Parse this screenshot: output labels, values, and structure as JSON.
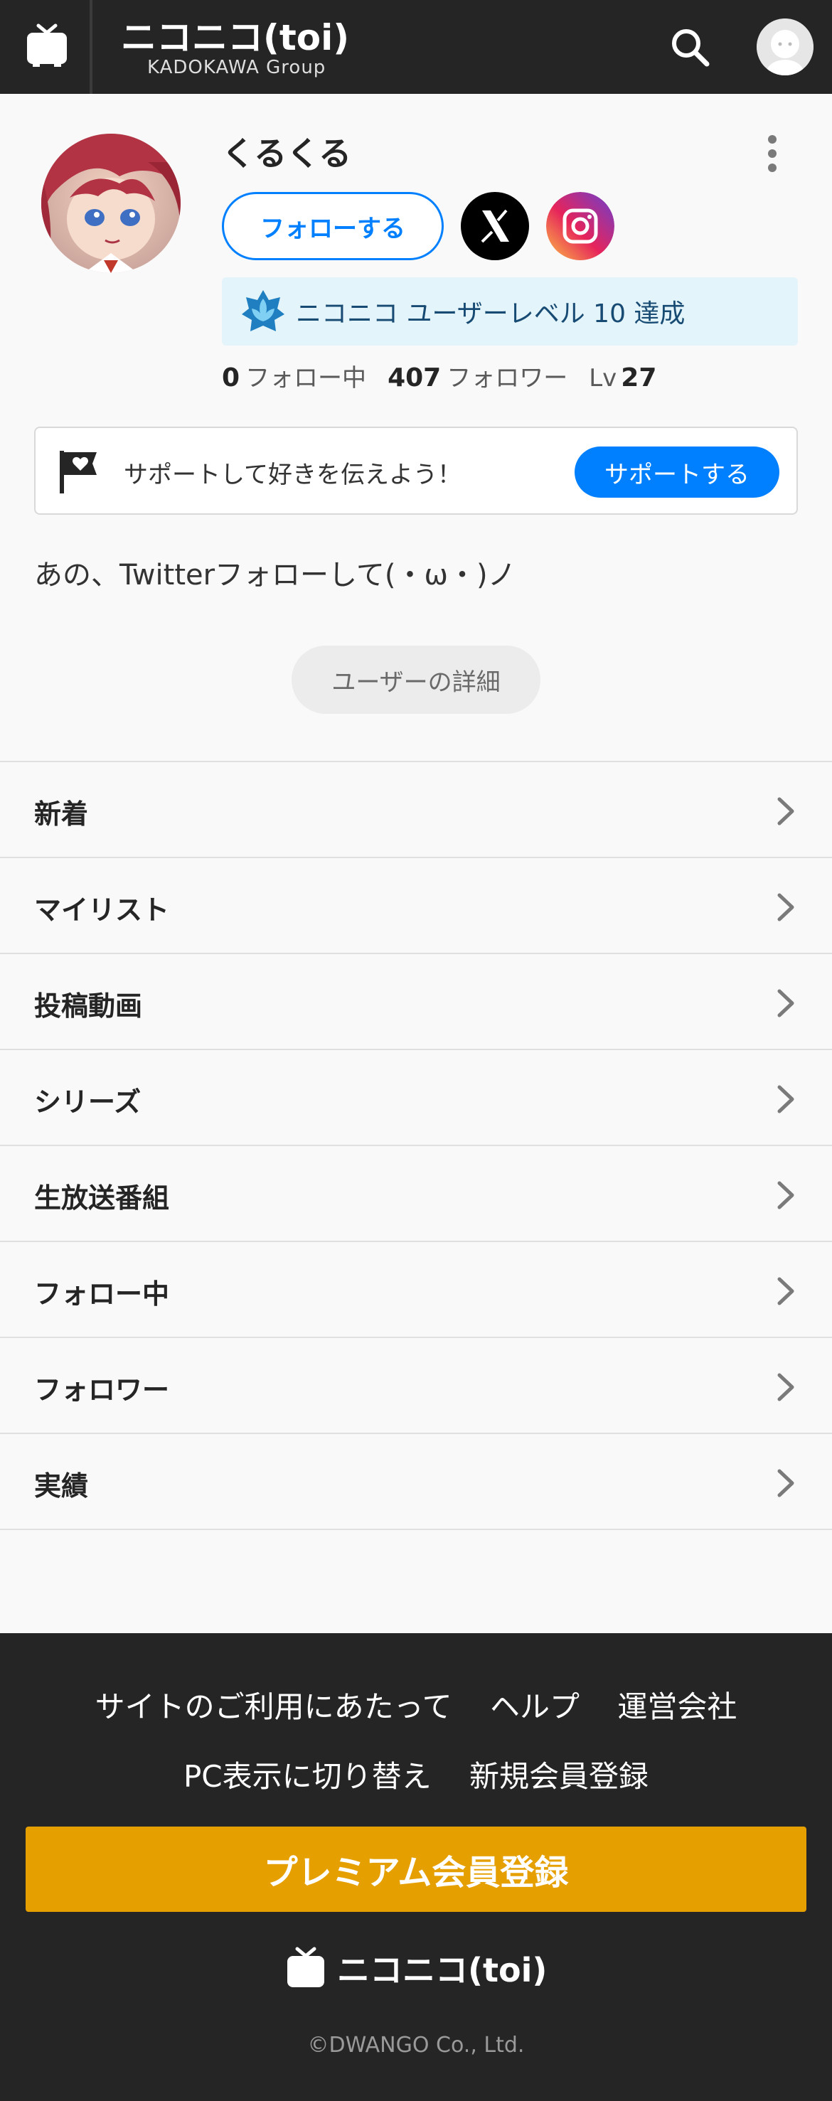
{
  "header": {
    "logo_text": "ニコニコ(toi)",
    "group_text": "KADOKAWA Group",
    "icons": {
      "tv": "tv-icon",
      "search": "search-icon",
      "account": "user-avatar-icon"
    }
  },
  "profile": {
    "name": "くるくる",
    "follow_label": "フォローする",
    "social": [
      "x-icon",
      "instagram-icon"
    ],
    "level_banner": "ニコニコ ユーザーレベル 10 達成",
    "stats": {
      "following_count": "0",
      "following_label": "フォロー中",
      "followers_count": "407",
      "followers_label": "フォロワー",
      "level_label": "Lv",
      "level_value": "27"
    }
  },
  "support": {
    "text": "サポートして好きを伝えよう！",
    "button": "サポートする"
  },
  "description": "あの、Twitterフォローして(・ω・)ノ",
  "detail_button": "ユーザーの詳細",
  "menu": [
    {
      "label": "新着"
    },
    {
      "label": "マイリスト"
    },
    {
      "label": "投稿動画"
    },
    {
      "label": "シリーズ"
    },
    {
      "label": "生放送番組"
    },
    {
      "label": "フォロー中"
    },
    {
      "label": "フォロワー"
    },
    {
      "label": "実績"
    }
  ],
  "footer": {
    "links_row1": [
      "サイトのご利用にあたって",
      "ヘルプ",
      "運営会社"
    ],
    "links_row2": [
      "PC表示に切り替え",
      "新規会員登録"
    ],
    "premium_button": "プレミアム会員登録",
    "logo_text": "ニコニコ(toi)",
    "copyright": "©DWANGO Co., Ltd."
  },
  "colors": {
    "header_bg": "#252525",
    "accent_blue": "#0080ff",
    "premium_gold": "#e5a000",
    "level_banner_bg": "#e3f4fa"
  }
}
